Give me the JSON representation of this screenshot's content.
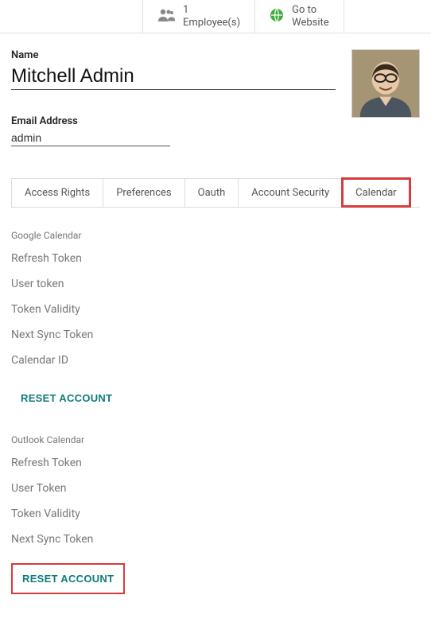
{
  "topbar": {
    "employees": {
      "count": "1",
      "label": "Employee(s)"
    },
    "website": {
      "line1": "Go to",
      "line2": "Website"
    }
  },
  "form": {
    "name_label": "Name",
    "name_value": "Mitchell Admin",
    "email_label": "Email Address",
    "email_value": "admin"
  },
  "tabs": {
    "items": [
      {
        "label": "Access Rights"
      },
      {
        "label": "Preferences"
      },
      {
        "label": "Oauth"
      },
      {
        "label": "Account Security"
      },
      {
        "label": "Calendar"
      }
    ]
  },
  "google": {
    "title": "Google Calendar",
    "fields": {
      "refresh": "Refresh Token",
      "user": "User token",
      "validity": "Token Validity",
      "next_sync": "Next Sync Token",
      "cal_id": "Calendar ID"
    },
    "reset": "RESET ACCOUNT"
  },
  "outlook": {
    "title": "Outlook Calendar",
    "fields": {
      "refresh": "Refresh Token",
      "user": "User Token",
      "validity": "Token Validity",
      "next_sync": "Next Sync Token"
    },
    "reset": "RESET ACCOUNT"
  }
}
